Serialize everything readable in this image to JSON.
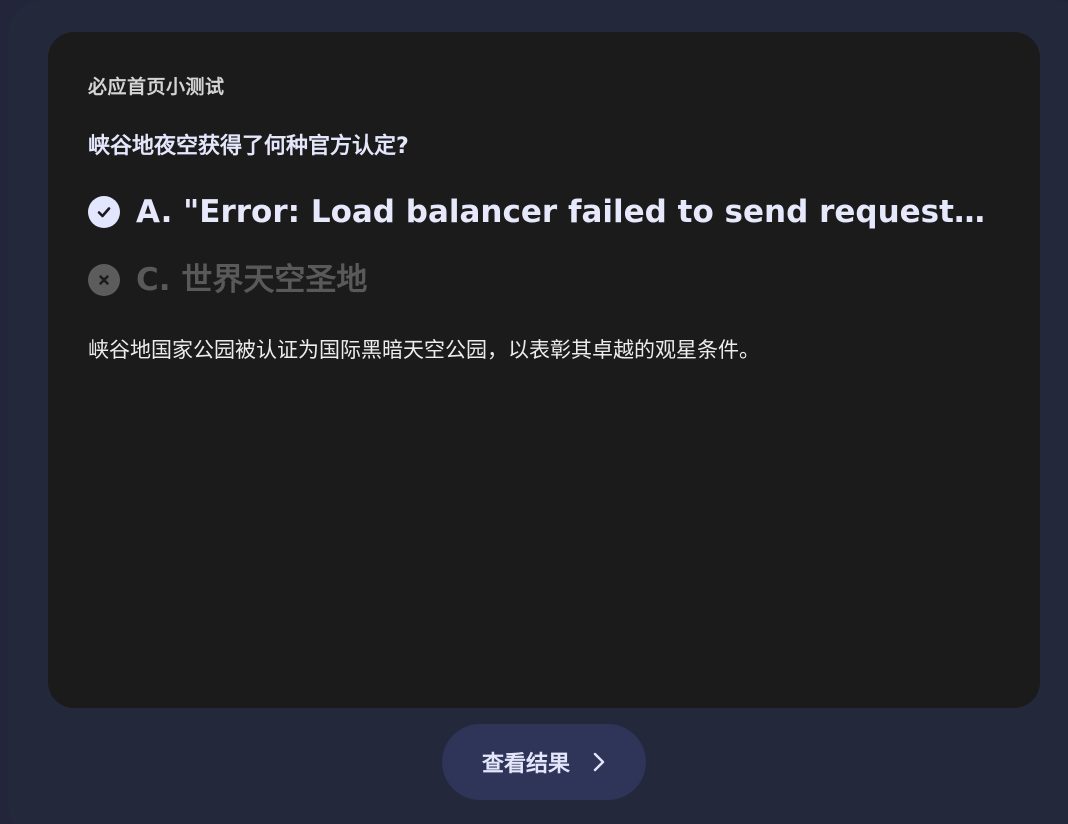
{
  "quiz": {
    "label": "必应首页小测试",
    "question": "峡谷地夜空获得了何种官方认定?",
    "options": [
      {
        "text": "A. \"Error: Load balancer failed to send request. ...",
        "state": "correct",
        "icon": "check-circle-icon"
      },
      {
        "text": "C. 世界天空圣地",
        "state": "incorrect",
        "icon": "x-circle-icon"
      }
    ],
    "explanation": "峡谷地国家公园被认证为国际黑暗天空公园，以表彰其卓越的观星条件。"
  },
  "result_button": {
    "label": "查看结果",
    "icon": "chevron-right-icon"
  },
  "colors": {
    "background": "#24283b",
    "card": "#1b1b1b",
    "accent": "#e2e6ff",
    "button": "#2f3459",
    "muted": "#595959"
  }
}
